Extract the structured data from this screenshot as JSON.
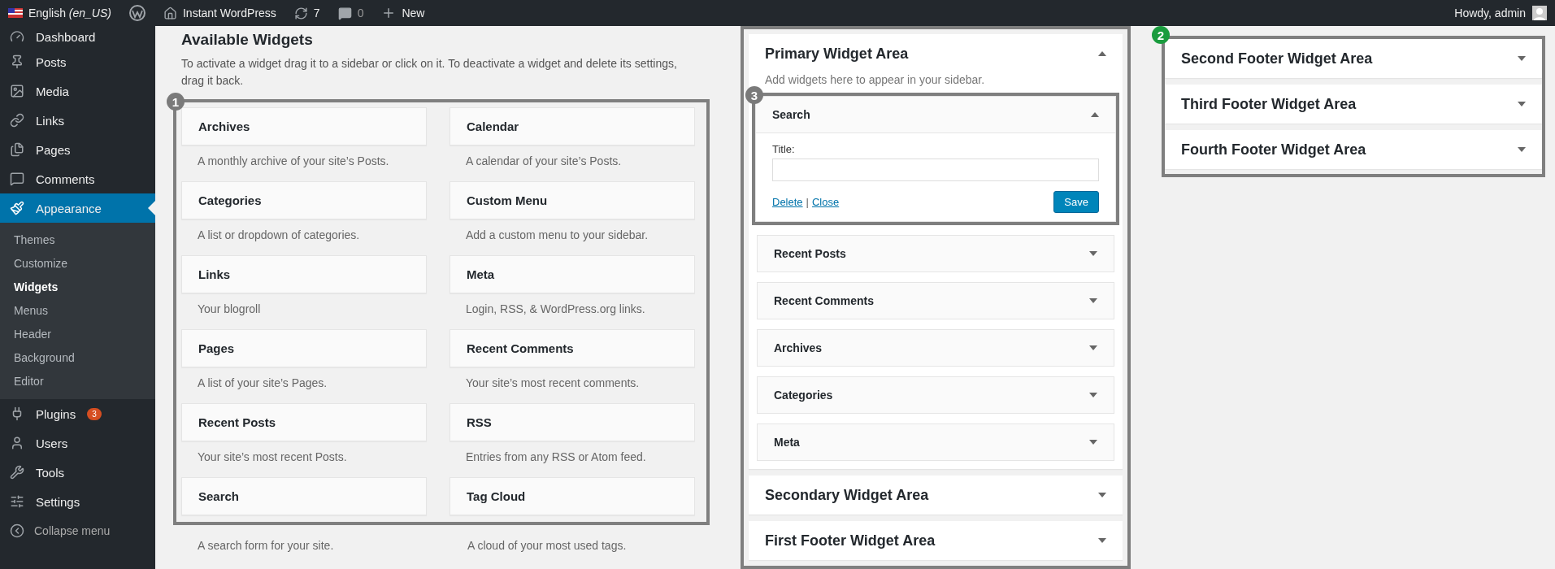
{
  "topbar": {
    "items": [
      {
        "kind": "language",
        "label": "English",
        "detail": "(en_US)"
      },
      {
        "kind": "logo"
      },
      {
        "kind": "site",
        "label": "Instant WordPress"
      },
      {
        "kind": "updates",
        "label": "7"
      },
      {
        "kind": "comments",
        "label": "0"
      },
      {
        "kind": "new",
        "label": "New"
      }
    ],
    "greeting": "Howdy, admin"
  },
  "sidebar": {
    "items": [
      {
        "label": "Dashboard",
        "selected": false
      },
      {
        "label": "Posts",
        "selected": false
      },
      {
        "label": "Media",
        "selected": false
      },
      {
        "label": "Links",
        "selected": false
      },
      {
        "label": "Pages",
        "selected": false
      },
      {
        "label": "Comments",
        "selected": false
      },
      {
        "label": "Appearance",
        "selected": true,
        "children": [
          {
            "label": "Themes",
            "selected": false
          },
          {
            "label": "Customize",
            "selected": false
          },
          {
            "label": "Widgets",
            "selected": true
          },
          {
            "label": "Menus",
            "selected": false
          },
          {
            "label": "Header",
            "selected": false
          },
          {
            "label": "Background",
            "selected": false
          },
          {
            "label": "Editor",
            "selected": false
          }
        ]
      },
      {
        "label": "Plugins",
        "selected": false,
        "badge": "3"
      },
      {
        "label": "Users",
        "selected": false
      },
      {
        "label": "Tools",
        "selected": false
      },
      {
        "label": "Settings",
        "selected": false
      }
    ],
    "collapse": "Collapse menu"
  },
  "available_widgets": {
    "title": "Available Widgets",
    "description": "To activate a widget drag it to a sidebar or click on it. To deactivate a widget and delete its settings, drag it back.",
    "annotation": {
      "number": "1",
      "color": "#7a7a7a"
    },
    "widgets": [
      {
        "name": "Archives",
        "description": "A monthly archive of your site’s Posts."
      },
      {
        "name": "Calendar",
        "description": "A calendar of your site’s Posts."
      },
      {
        "name": "Categories",
        "description": "A list or dropdown of categories."
      },
      {
        "name": "Custom Menu",
        "description": "Add a custom menu to your sidebar."
      },
      {
        "name": "Links",
        "description": "Your blogroll"
      },
      {
        "name": "Meta",
        "description": "Login, RSS, & WordPress.org links."
      },
      {
        "name": "Pages",
        "description": "A list of your site’s Pages."
      },
      {
        "name": "Recent Comments",
        "description": "Your site’s most recent comments."
      },
      {
        "name": "Recent Posts",
        "description": "Your site’s most recent Posts."
      },
      {
        "name": "RSS",
        "description": "Entries from any RSS or Atom feed."
      },
      {
        "name": "Search",
        "description": "A search form for your site."
      },
      {
        "name": "Tag Cloud",
        "description": "A cloud of your most used tags."
      }
    ]
  },
  "widget_areas_annotation": {
    "number": "2",
    "color": "#1a9c3e"
  },
  "widget_areas": [
    {
      "title": "Primary Widget Area",
      "expanded": true,
      "description": "Add widgets here to appear in your sidebar.",
      "widgets": [
        {
          "name": "Search",
          "expanded": true,
          "annotation": {
            "number": "3",
            "color": "#7a7a7a"
          },
          "form": {
            "label": "Title:",
            "delete": "Delete",
            "separator": "|",
            "close": "Close",
            "save": "Save"
          }
        },
        {
          "name": "Recent Posts",
          "expanded": false
        },
        {
          "name": "Recent Comments",
          "expanded": false
        },
        {
          "name": "Archives",
          "expanded": false
        },
        {
          "name": "Categories",
          "expanded": false
        },
        {
          "name": "Meta",
          "expanded": false
        }
      ]
    },
    {
      "title": "Secondary Widget Area",
      "expanded": false
    },
    {
      "title": "First Footer Widget Area",
      "expanded": false
    },
    {
      "title": "Second Footer Widget Area",
      "expanded": false
    },
    {
      "title": "Third Footer Widget Area",
      "expanded": false
    },
    {
      "title": "Fourth Footer Widget Area",
      "expanded": false
    }
  ]
}
